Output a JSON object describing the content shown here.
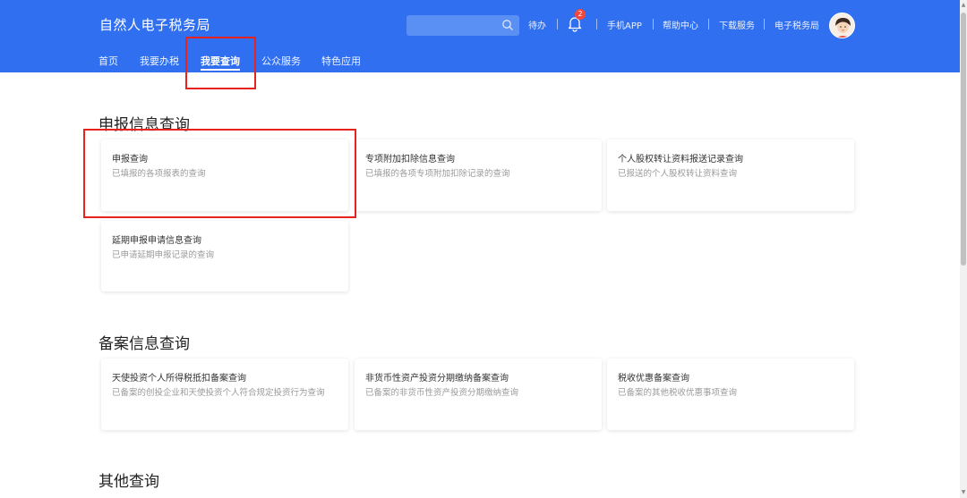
{
  "header": {
    "site_title": "自然人电子税务局",
    "search_placeholder": "",
    "pending_label": "待办",
    "notification_count": "2",
    "links": {
      "mobile_app": "手机APP",
      "help_center": "帮助中心",
      "download_service": "下载服务",
      "e_tax_bureau": "电子税务局"
    },
    "colors": {
      "header_bg": "#2f6ff0",
      "highlight": "#e8231d"
    }
  },
  "nav": {
    "items": [
      "首页",
      "我要办税",
      "我要查询",
      "公众服务",
      "特色应用"
    ],
    "active": "我要查询"
  },
  "sections": [
    {
      "title": "申报信息查询",
      "cards": [
        {
          "title": "申报查询",
          "desc": "已填报的各项报表的查询"
        },
        {
          "title": "专项附加扣除信息查询",
          "desc": "已填报的各项专项附加扣除记录的查询"
        },
        {
          "title": "个人股权转让资料报送记录查询",
          "desc": "已报送的个人股权转让资料查询"
        },
        {
          "title": "延期申报申请信息查询",
          "desc": "已申请延期申报记录的查询"
        }
      ]
    },
    {
      "title": "备案信息查询",
      "cards": [
        {
          "title": "天使投资个人所得税抵扣备案查询",
          "desc": "已备案的创投企业和天使投资个人符合规定投资行为查询"
        },
        {
          "title": "非货币性资产投资分期缴纳备案查询",
          "desc": "已备案的非货币性资产投资分期缴纳查询"
        },
        {
          "title": "税收优惠备案查询",
          "desc": "已备案的其他税收优惠事项查询"
        }
      ]
    },
    {
      "title": "其他查询",
      "cards": []
    }
  ]
}
